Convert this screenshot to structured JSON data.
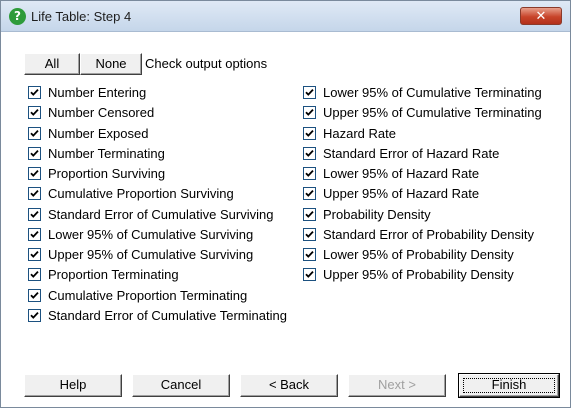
{
  "window": {
    "title": "Life Table: Step 4",
    "title_icon": "help-question-icon",
    "close_icon": "close-icon",
    "close_glyph": "✕"
  },
  "toolbar": {
    "all_label": "All",
    "none_label": "None",
    "check_output_label": "Check output options"
  },
  "options_left": [
    {
      "label": "Number Entering",
      "checked": true
    },
    {
      "label": "Number Censored",
      "checked": true
    },
    {
      "label": "Number Exposed",
      "checked": true
    },
    {
      "label": "Number Terminating",
      "checked": true
    },
    {
      "label": "Proportion Surviving",
      "checked": true
    },
    {
      "label": "Cumulative Proportion Surviving",
      "checked": true
    },
    {
      "label": "Standard Error of Cumulative Surviving",
      "checked": true
    },
    {
      "label": "Lower 95% of Cumulative Surviving",
      "checked": true
    },
    {
      "label": "Upper 95% of Cumulative Surviving",
      "checked": true
    },
    {
      "label": "Proportion Terminating",
      "checked": true
    },
    {
      "label": "Cumulative Proportion Terminating",
      "checked": true
    },
    {
      "label": "Standard Error of Cumulative Terminating",
      "checked": true
    }
  ],
  "options_right": [
    {
      "label": "Lower 95% of Cumulative Terminating",
      "checked": true
    },
    {
      "label": "Upper 95% of Cumulative Terminating",
      "checked": true
    },
    {
      "label": "Hazard Rate",
      "checked": true
    },
    {
      "label": "Standard Error of Hazard Rate",
      "checked": true
    },
    {
      "label": "Lower 95% of Hazard Rate",
      "checked": true
    },
    {
      "label": "Upper 95% of Hazard Rate",
      "checked": true
    },
    {
      "label": "Probability Density",
      "checked": true
    },
    {
      "label": "Standard Error of Probability Density",
      "checked": true
    },
    {
      "label": "Lower 95% of Probability Density",
      "checked": true
    },
    {
      "label": "Upper 95% of Probability Density",
      "checked": true
    }
  ],
  "footer": {
    "help_label": "Help",
    "cancel_label": "Cancel",
    "back_label": "< Back",
    "next_label": "Next >",
    "finish_label": "Finish",
    "next_enabled": false
  }
}
